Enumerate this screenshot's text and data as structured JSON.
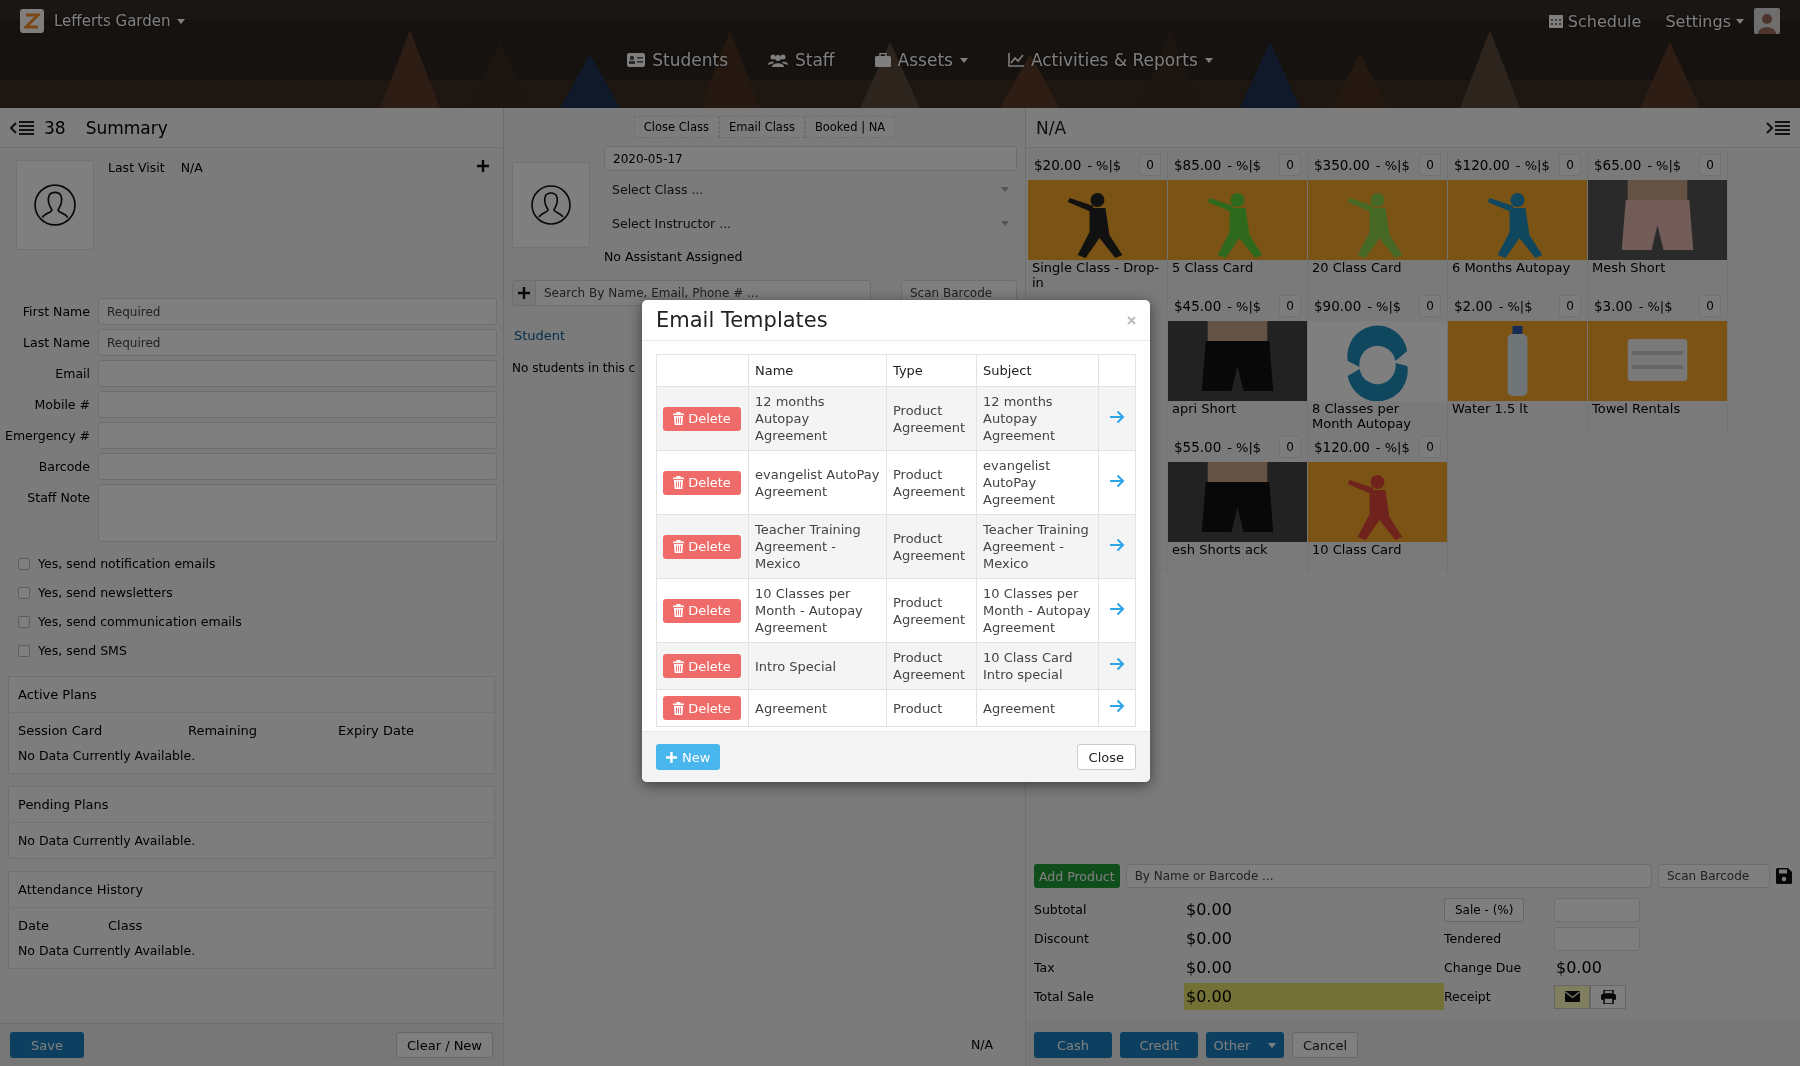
{
  "header": {
    "location": "Lefferts Garden",
    "nav": [
      {
        "label": "Students",
        "kind": "students",
        "dropdown": false
      },
      {
        "label": "Staff",
        "kind": "staff",
        "dropdown": false
      },
      {
        "label": "Assets",
        "kind": "assets",
        "dropdown": true
      },
      {
        "label": "Activities & Reports",
        "kind": "reports",
        "dropdown": true
      }
    ],
    "schedule": "Schedule",
    "settings": "Settings"
  },
  "client": {
    "count": "38",
    "title": "Summary",
    "last_visit_label": "Last Visit",
    "last_visit": "N/A",
    "fields": [
      {
        "label": "First Name",
        "placeholder": "Required",
        "kind": "input"
      },
      {
        "label": "Last Name",
        "placeholder": "Required",
        "kind": "input"
      },
      {
        "label": "Email",
        "kind": "input"
      },
      {
        "label": "Mobile #",
        "kind": "input"
      },
      {
        "label": "Emergency #",
        "kind": "input"
      },
      {
        "label": "Barcode",
        "kind": "input"
      },
      {
        "label": "Staff Note",
        "kind": "textarea"
      }
    ],
    "checkboxes": [
      {
        "label": "Yes, send notification emails",
        "checked": false
      },
      {
        "label": "Yes, send newsletters",
        "checked": false
      },
      {
        "label": "Yes, send communication emails",
        "checked": false
      },
      {
        "label": "Yes, send SMS",
        "checked": false
      }
    ],
    "panels": [
      {
        "title": "Active Plans",
        "columns": [
          "Session Card",
          "Remaining",
          "Expiry Date"
        ],
        "empty": "No Data Currently Available."
      },
      {
        "title": "Pending Plans",
        "empty": "No Data Currently Available."
      },
      {
        "title": "Attendance History",
        "columns": [
          "Date",
          "Class"
        ],
        "empty": "No Data Currently Available."
      }
    ],
    "save": "Save",
    "clear": "Clear / New"
  },
  "class_panel": {
    "actions": [
      "Close Class",
      "Email Class",
      "Booked | NA"
    ],
    "date": "2020-05-17",
    "selects": [
      "Select Class ...",
      "Select Instructor ..."
    ],
    "assistant": "No Assistant Assigned",
    "search_placeholder": "Search By Name, Email, Phone # ...",
    "barcode_placeholder": "Scan Barcode",
    "student_heading": "Student",
    "empty": "No students in this c",
    "footer": "N/A"
  },
  "pos": {
    "title": "N/A",
    "products": [
      {
        "kind": "product",
        "price": "$20.00",
        "discount": "- %|$",
        "qty": "0",
        "name": "Single Class - Drop-in"
      },
      {
        "kind": "product",
        "price": "$85.00",
        "discount": "- %|$",
        "qty": "0",
        "name": "5 Class Card"
      },
      {
        "kind": "product",
        "price": "$350.00",
        "discount": "- %|$",
        "qty": "0",
        "name": "20 Class Card"
      },
      {
        "kind": "product",
        "price": "$120.00",
        "discount": "- %|$",
        "qty": "0",
        "name": "6 Months Autopay"
      },
      {
        "kind": "product",
        "price": "$65.00",
        "discount": "- %|$",
        "qty": "0",
        "name": "Mesh Short"
      },
      {
        "kind": "covered"
      },
      {
        "kind": "product",
        "price": "$45.00",
        "discount": "- %|$",
        "qty": "0",
        "name": "apri Short"
      },
      {
        "kind": "product",
        "price": "$90.00",
        "discount": "- %|$",
        "qty": "0",
        "name": "8 Classes per Month Autopay"
      },
      {
        "kind": "product",
        "price": "$2.00",
        "discount": "- %|$",
        "qty": "0",
        "name": "Water 1.5 lt"
      },
      {
        "kind": "product",
        "price": "$3.00",
        "discount": "- %|$",
        "qty": "0",
        "name": "Towel Rentals"
      },
      {
        "kind": "covered"
      },
      {
        "kind": "product",
        "price": "$55.00",
        "discount": "- %|$",
        "qty": "0",
        "name": "esh Shorts ack"
      },
      {
        "kind": "product",
        "price": "$120.00",
        "discount": "- %|$",
        "qty": "0",
        "name": "10 Class Card"
      }
    ],
    "add_product": "Add Product",
    "search_placeholder": "By Name or Barcode ...",
    "barcode_placeholder": "Scan Barcode",
    "totals": [
      {
        "label": "Subtotal",
        "value": "$0.00",
        "highlight": false
      },
      {
        "label": "Discount",
        "value": "$0.00",
        "highlight": false
      },
      {
        "label": "Tax",
        "value": "$0.00",
        "highlight": false
      },
      {
        "label": "Total Sale",
        "value": "$0.00",
        "highlight": true
      }
    ],
    "sale_button": "Sale - (%)",
    "tendered_label": "Tendered",
    "change_label": "Change Due",
    "change": "$0.00",
    "receipt_label": "Receipt",
    "receipt": [
      {
        "kind": "email",
        "selected": true
      },
      {
        "kind": "print",
        "selected": false
      }
    ],
    "payments": [
      "Cash",
      "Credit",
      "Other"
    ],
    "cancel": "Cancel"
  },
  "modal": {
    "title": "Email Templates",
    "columns": [
      "Name",
      "Type",
      "Subject"
    ],
    "rows": [
      {
        "action": "Delete",
        "name": "12 months Autopay Agreement",
        "type": "Product Agreement",
        "subject": "12 months Autopay Agreement"
      },
      {
        "action": "Delete",
        "name": "evangelist AutoPay Agreement",
        "type": "Product Agreement",
        "subject": "evangelist AutoPay Agreement"
      },
      {
        "action": "Delete",
        "name": "Teacher Training Agreement - Mexico",
        "type": "Product Agreement",
        "subject": "Teacher Training Agreement - Mexico"
      },
      {
        "action": "Delete",
        "name": "10 Classes per Month - Autopay Agreement",
        "type": "Product Agreement",
        "subject": "10 Classes per Month - Autopay Agreement"
      },
      {
        "action": "Delete",
        "name": "Intro Special",
        "type": "Product Agreement",
        "subject": "10 Class Card Intro special"
      },
      {
        "action": "Delete",
        "name": "Agreement",
        "type": "Product",
        "subject": "Agreement"
      }
    ],
    "new": "New",
    "close": "Close"
  }
}
